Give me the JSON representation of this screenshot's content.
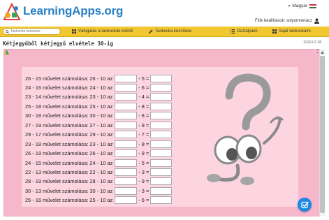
{
  "header": {
    "logo_text": "LearningApps.org",
    "language": "Magyar",
    "account_label": "Fiók beállítások: solyomneracz"
  },
  "navbar": {
    "search_placeholder": "Tankocka keresése",
    "items": [
      {
        "label": "Válogatás a tankockák között",
        "icon": "grid-icon"
      },
      {
        "label": "Tankocka készítése",
        "icon": "pencil-icon"
      },
      {
        "label": "Osztályaim",
        "icon": "list-icon"
      },
      {
        "label": "Saját tankockáim",
        "icon": "grid-icon"
      }
    ]
  },
  "app": {
    "title": "Kétjegyűből kétjegyű elvétele 30-ig",
    "date": "2020-07-28",
    "rows": [
      {
        "q": "26 - 15 művelet számolása: 26 - 10 az",
        "op": "- 5 ="
      },
      {
        "q": "24 - 16 művelet számolása: 24 - 10 az",
        "op": "- 6 ="
      },
      {
        "q": "23 - 14 művelet számolása: 23 - 10 az",
        "op": "- 4 ="
      },
      {
        "q": "25 - 18 művelet számolása: 25 - 10 az",
        "op": "- 8 ="
      },
      {
        "q": "30 - 18 művelet számolása: 30 - 10 az",
        "op": "- 8 ="
      },
      {
        "q": "27 - 19 művelet számolása: 27 - 10 az",
        "op": "- 9 ="
      },
      {
        "q": "29 - 17 művelet számolása: 29 - 10 az",
        "op": "- 7 ="
      },
      {
        "q": "23 - 18 művelet számolása: 23 - 10 az",
        "op": "- 8 ="
      },
      {
        "q": "26 - 19 művelet számolása: 26 - 10 az",
        "op": "- 9 ="
      },
      {
        "q": "24 - 15 művelet számolása: 24 - 10 az",
        "op": "- 5 ="
      },
      {
        "q": "22 - 13 művelet számolása: 22 - 10 az",
        "op": "- 3 ="
      },
      {
        "q": "28 - 19 művelet számolása: 28 - 10 az",
        "op": "- 9 ="
      },
      {
        "q": "30 - 13 művelet számolása: 30 - 10 az",
        "op": "- 3 ="
      },
      {
        "q": "25 - 16 művelet számolása: 25 - 10 az",
        "op": "- 6 ="
      }
    ]
  },
  "colors": {
    "brand": "#2a7fc7",
    "navbar": "#f1c832",
    "frame": "#f7b7cb",
    "panel": "#fcd5e1",
    "fab": "#1e88e5"
  }
}
